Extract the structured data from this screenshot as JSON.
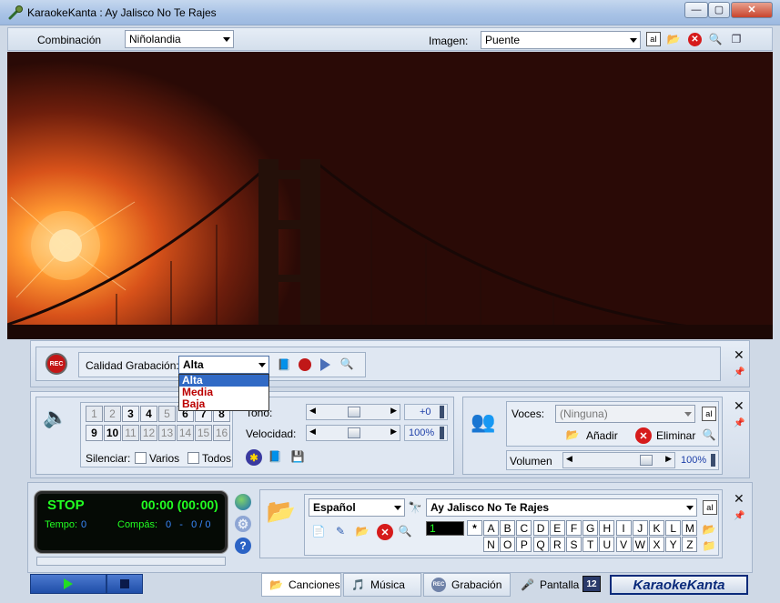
{
  "window": {
    "title": "KaraokeKanta : Ay Jalisco No Te Rajes",
    "minimize_glyph": "—",
    "maximize_glyph": "▢",
    "close_glyph": "✕"
  },
  "topbar": {
    "combinacion_label": "Combinación",
    "combinacion_value": "Niñolandia",
    "imagen_label": "Imagen:",
    "imagen_value": "Puente"
  },
  "recording": {
    "rec_icon_text": "REC",
    "quality_label": "Calidad Grabación:",
    "quality_value": "Alta",
    "quality_options": [
      "Alta",
      "Media",
      "Baja"
    ]
  },
  "music": {
    "channels_row1": [
      "1",
      "2",
      "3",
      "4",
      "5",
      "6",
      "7",
      "8"
    ],
    "channels_row2": [
      "9",
      "10",
      "11",
      "12",
      "13",
      "14",
      "15",
      "16"
    ],
    "silenciar_label": "Silenciar:",
    "varios_label": "Varios",
    "todos_label": "Todos",
    "tono_label": "Tono:",
    "tono_value": "+0",
    "velocidad_label": "Velocidad:",
    "velocidad_value": "100%",
    "tono_level": 0.5,
    "velocidad_level": 0.5
  },
  "voices": {
    "voces_label": "Voces:",
    "voces_value": "(Ninguna)",
    "add_label": "Añadir",
    "remove_label": "Eliminar",
    "volumen_label": "Volumen",
    "volumen_value": "100%",
    "volumen_level": 0.85
  },
  "status": {
    "state": "STOP",
    "time": "00:00 (00:00)",
    "tempo_label": "Tempo:",
    "tempo_value": "0",
    "compas_label": "Compás:",
    "compas_value": "0   -   0 / 0"
  },
  "songs": {
    "language_value": "Español",
    "song_value": "Ay Jalisco No Te Rajes",
    "counter_value": "1",
    "star": "*",
    "letters_row1": [
      "A",
      "B",
      "C",
      "D",
      "E",
      "F",
      "G",
      "H",
      "I",
      "J",
      "K",
      "L",
      "M"
    ],
    "letters_row2": [
      "N",
      "O",
      "P",
      "Q",
      "R",
      "S",
      "T",
      "U",
      "V",
      "W",
      "X",
      "Y",
      "Z"
    ]
  },
  "tabs": {
    "canciones": "Canciones",
    "musica": "Música",
    "grabacion": "Grabación",
    "pantalla": "Pantalla",
    "twelve": "12",
    "brand": "KaraokeKanta"
  },
  "colors": {
    "status_bg": "#050a05",
    "status_text": "#22ff22",
    "accent_red": "#cc1111",
    "selection": "#316ac5",
    "brand_blue": "#0a2a7a"
  }
}
